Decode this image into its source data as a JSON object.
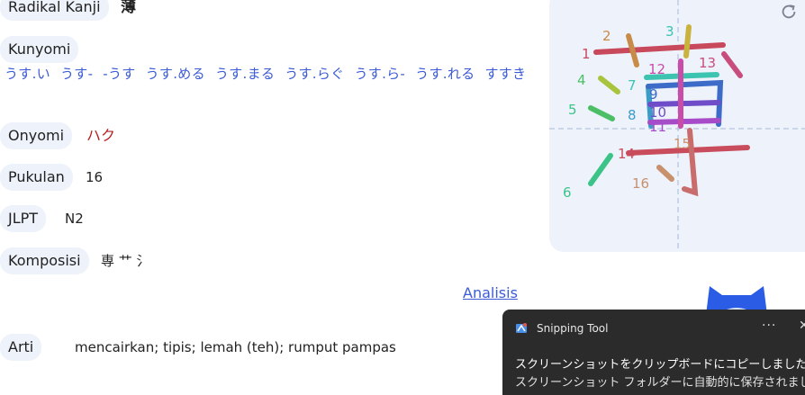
{
  "fields": {
    "radikal": {
      "label": "Radikal Kanji",
      "value": "薄"
    },
    "kunyomi": {
      "label": "Kunyomi",
      "readings": [
        "うす.い",
        "うす-",
        "-うす",
        "うす.める",
        "うす.まる",
        "うす.らぐ",
        "うす.ら-",
        "うす.れる",
        "すすき"
      ]
    },
    "onyomi": {
      "label": "Onyomi",
      "value": "ハク"
    },
    "pukulan": {
      "label": "Pukulan",
      "value": "16"
    },
    "jlpt": {
      "label": "JLPT",
      "value": "N2"
    },
    "komposisi": {
      "label": "Komposisi",
      "value": "専 艹 氵"
    },
    "arti": {
      "label": "Arti",
      "value": "mencairkan; tipis; lemah (teh); rumput pampas"
    }
  },
  "analisis_link": "Analisis",
  "stroke_diagram": {
    "numbers": [
      "1",
      "2",
      "3",
      "4",
      "5",
      "6",
      "7",
      "8",
      "9",
      "10",
      "11",
      "12",
      "13",
      "14",
      "15",
      "16"
    ]
  },
  "toast": {
    "app": "Snipping Tool",
    "more": "···",
    "close": "✕",
    "line1": "スクリーンショットをクリップボードにコピーしました",
    "line2": "スクリーンショット フォルダーに自動的に保存されました。"
  },
  "colors": {
    "link": "#3b5bd6",
    "onyomi": "#b22222",
    "pill_bg": "#eef2fa",
    "toast_bg": "#2b2b2b"
  }
}
